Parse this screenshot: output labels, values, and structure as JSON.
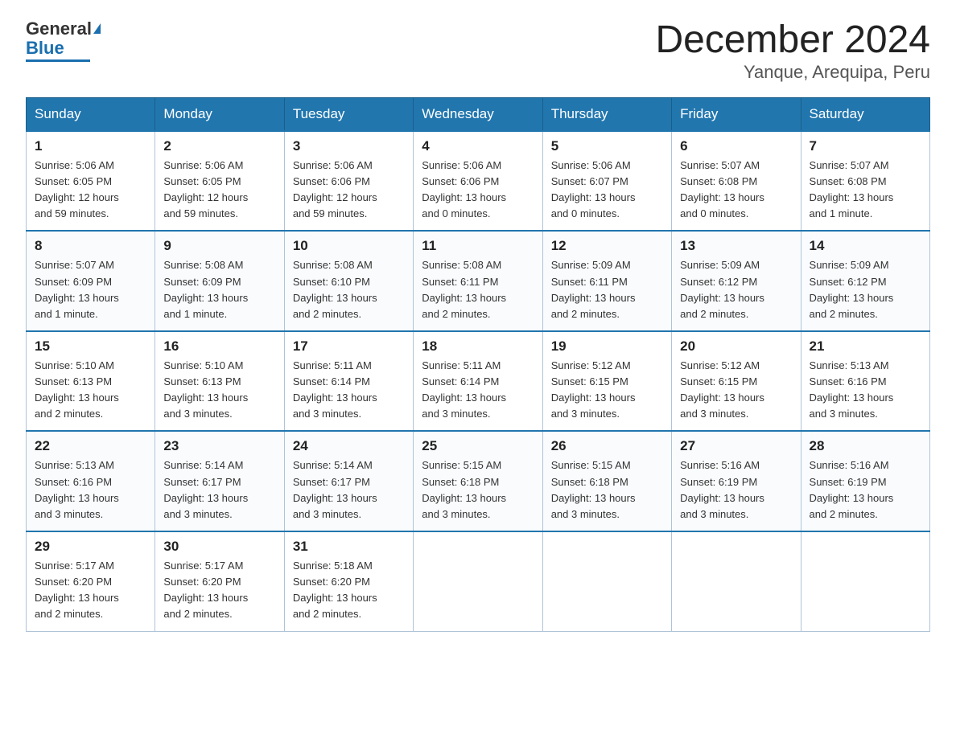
{
  "header": {
    "logo_general": "General",
    "logo_blue": "Blue",
    "month_title": "December 2024",
    "location": "Yanque, Arequipa, Peru"
  },
  "days_of_week": [
    "Sunday",
    "Monday",
    "Tuesday",
    "Wednesday",
    "Thursday",
    "Friday",
    "Saturday"
  ],
  "weeks": [
    [
      {
        "day": "1",
        "sunrise": "5:06 AM",
        "sunset": "6:05 PM",
        "daylight": "12 hours and 59 minutes."
      },
      {
        "day": "2",
        "sunrise": "5:06 AM",
        "sunset": "6:05 PM",
        "daylight": "12 hours and 59 minutes."
      },
      {
        "day": "3",
        "sunrise": "5:06 AM",
        "sunset": "6:06 PM",
        "daylight": "12 hours and 59 minutes."
      },
      {
        "day": "4",
        "sunrise": "5:06 AM",
        "sunset": "6:06 PM",
        "daylight": "13 hours and 0 minutes."
      },
      {
        "day": "5",
        "sunrise": "5:06 AM",
        "sunset": "6:07 PM",
        "daylight": "13 hours and 0 minutes."
      },
      {
        "day": "6",
        "sunrise": "5:07 AM",
        "sunset": "6:08 PM",
        "daylight": "13 hours and 0 minutes."
      },
      {
        "day": "7",
        "sunrise": "5:07 AM",
        "sunset": "6:08 PM",
        "daylight": "13 hours and 1 minute."
      }
    ],
    [
      {
        "day": "8",
        "sunrise": "5:07 AM",
        "sunset": "6:09 PM",
        "daylight": "13 hours and 1 minute."
      },
      {
        "day": "9",
        "sunrise": "5:08 AM",
        "sunset": "6:09 PM",
        "daylight": "13 hours and 1 minute."
      },
      {
        "day": "10",
        "sunrise": "5:08 AM",
        "sunset": "6:10 PM",
        "daylight": "13 hours and 2 minutes."
      },
      {
        "day": "11",
        "sunrise": "5:08 AM",
        "sunset": "6:11 PM",
        "daylight": "13 hours and 2 minutes."
      },
      {
        "day": "12",
        "sunrise": "5:09 AM",
        "sunset": "6:11 PM",
        "daylight": "13 hours and 2 minutes."
      },
      {
        "day": "13",
        "sunrise": "5:09 AM",
        "sunset": "6:12 PM",
        "daylight": "13 hours and 2 minutes."
      },
      {
        "day": "14",
        "sunrise": "5:09 AM",
        "sunset": "6:12 PM",
        "daylight": "13 hours and 2 minutes."
      }
    ],
    [
      {
        "day": "15",
        "sunrise": "5:10 AM",
        "sunset": "6:13 PM",
        "daylight": "13 hours and 2 minutes."
      },
      {
        "day": "16",
        "sunrise": "5:10 AM",
        "sunset": "6:13 PM",
        "daylight": "13 hours and 3 minutes."
      },
      {
        "day": "17",
        "sunrise": "5:11 AM",
        "sunset": "6:14 PM",
        "daylight": "13 hours and 3 minutes."
      },
      {
        "day": "18",
        "sunrise": "5:11 AM",
        "sunset": "6:14 PM",
        "daylight": "13 hours and 3 minutes."
      },
      {
        "day": "19",
        "sunrise": "5:12 AM",
        "sunset": "6:15 PM",
        "daylight": "13 hours and 3 minutes."
      },
      {
        "day": "20",
        "sunrise": "5:12 AM",
        "sunset": "6:15 PM",
        "daylight": "13 hours and 3 minutes."
      },
      {
        "day": "21",
        "sunrise": "5:13 AM",
        "sunset": "6:16 PM",
        "daylight": "13 hours and 3 minutes."
      }
    ],
    [
      {
        "day": "22",
        "sunrise": "5:13 AM",
        "sunset": "6:16 PM",
        "daylight": "13 hours and 3 minutes."
      },
      {
        "day": "23",
        "sunrise": "5:14 AM",
        "sunset": "6:17 PM",
        "daylight": "13 hours and 3 minutes."
      },
      {
        "day": "24",
        "sunrise": "5:14 AM",
        "sunset": "6:17 PM",
        "daylight": "13 hours and 3 minutes."
      },
      {
        "day": "25",
        "sunrise": "5:15 AM",
        "sunset": "6:18 PM",
        "daylight": "13 hours and 3 minutes."
      },
      {
        "day": "26",
        "sunrise": "5:15 AM",
        "sunset": "6:18 PM",
        "daylight": "13 hours and 3 minutes."
      },
      {
        "day": "27",
        "sunrise": "5:16 AM",
        "sunset": "6:19 PM",
        "daylight": "13 hours and 3 minutes."
      },
      {
        "day": "28",
        "sunrise": "5:16 AM",
        "sunset": "6:19 PM",
        "daylight": "13 hours and 2 minutes."
      }
    ],
    [
      {
        "day": "29",
        "sunrise": "5:17 AM",
        "sunset": "6:20 PM",
        "daylight": "13 hours and 2 minutes."
      },
      {
        "day": "30",
        "sunrise": "5:17 AM",
        "sunset": "6:20 PM",
        "daylight": "13 hours and 2 minutes."
      },
      {
        "day": "31",
        "sunrise": "5:18 AM",
        "sunset": "6:20 PM",
        "daylight": "13 hours and 2 minutes."
      },
      null,
      null,
      null,
      null
    ]
  ],
  "labels": {
    "sunrise": "Sunrise:",
    "sunset": "Sunset:",
    "daylight": "Daylight:"
  }
}
